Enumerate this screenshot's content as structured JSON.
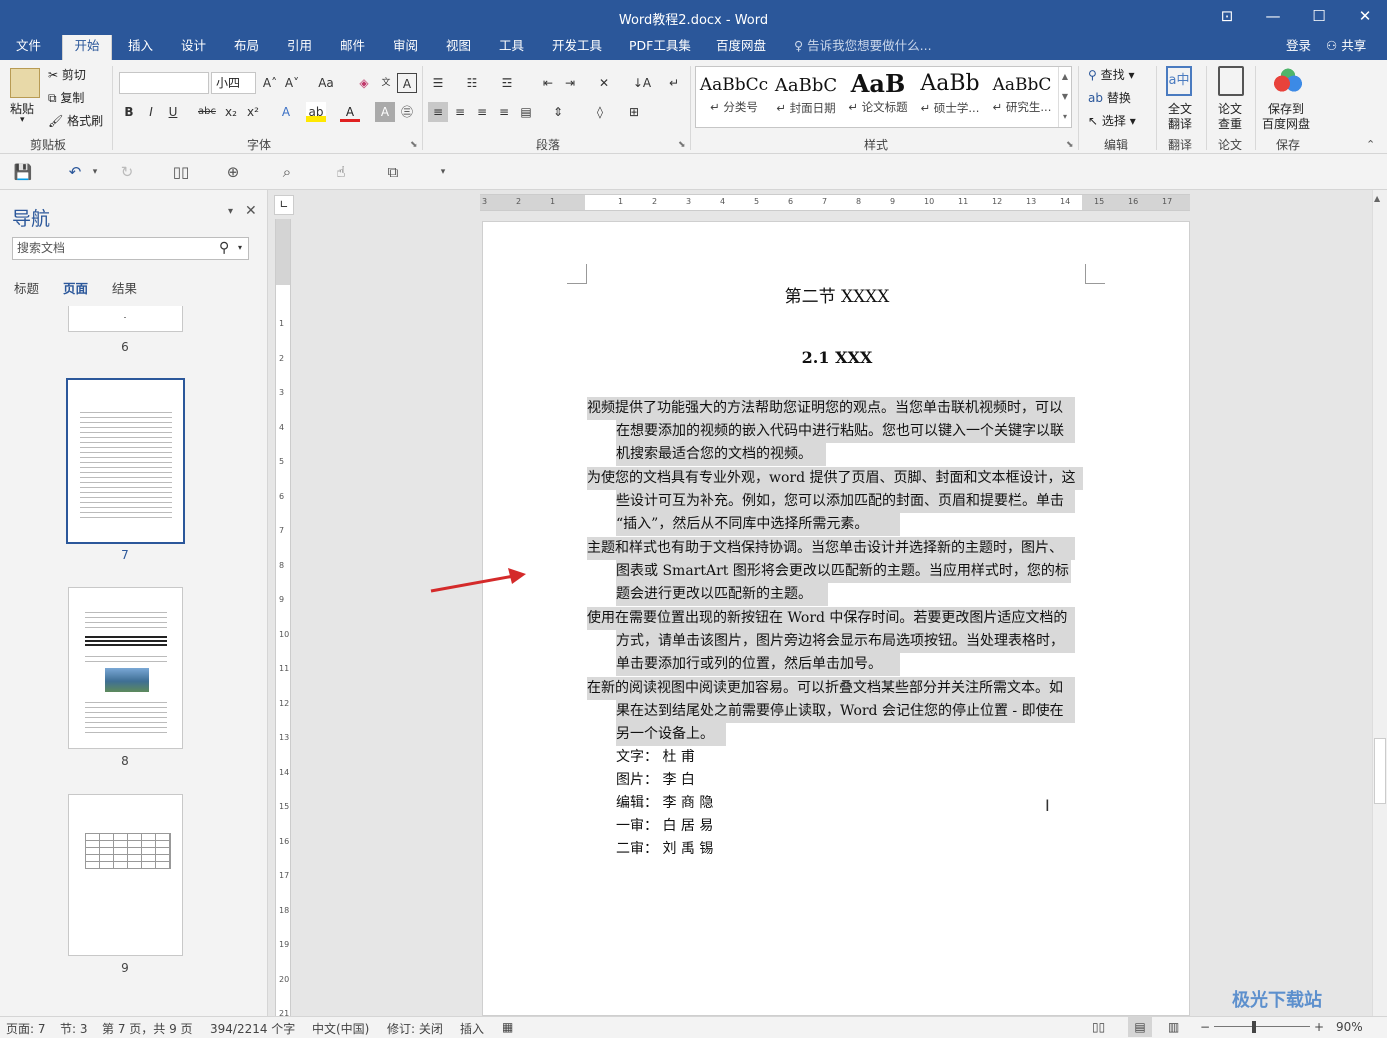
{
  "window": {
    "title": "Word教程2.docx - Word",
    "controls": [
      "⊡",
      "—",
      "☐",
      "✕"
    ]
  },
  "tabs": [
    "文件",
    "开始",
    "插入",
    "设计",
    "布局",
    "引用",
    "邮件",
    "审阅",
    "视图",
    "工具",
    "开发工具",
    "PDF工具集",
    "百度网盘"
  ],
  "tell_me": "告诉我您想要做什么...",
  "account": {
    "login": "登录",
    "share": "共享"
  },
  "ribbon": {
    "clipboard": {
      "paste": "粘贴",
      "cut": "剪切",
      "copy": "复制",
      "format_painter": "格式刷",
      "label": "剪贴板"
    },
    "font": {
      "font_name": "",
      "font_size": "小四",
      "label": "字体",
      "change_case": "Aa"
    },
    "paragraph": {
      "label": "段落"
    },
    "styles": {
      "label": "样式",
      "items": [
        {
          "sample": "AaBbCc",
          "name": "↵ 分类号"
        },
        {
          "sample": "AaBbC",
          "name": "↵ 封面日期"
        },
        {
          "sample": "AaB",
          "name": "↵ 论文标题"
        },
        {
          "sample": "AaBb",
          "name": "↵ 硕士学..."
        },
        {
          "sample": "AaBbC",
          "name": "↵ 研究生..."
        }
      ]
    },
    "editing": {
      "find": "查找",
      "replace": "替换",
      "select": "选择",
      "label": "编辑"
    },
    "translate": {
      "btn": "全文\n翻译",
      "btn1": "全文",
      "btn2": "翻译",
      "label": "翻译"
    },
    "paper": {
      "btn1": "论文",
      "btn2": "查重",
      "label": "论文"
    },
    "save": {
      "btn1": "保存到",
      "btn2": "百度网盘",
      "label": "保存"
    }
  },
  "nav": {
    "title": "导航",
    "search_placeholder": "搜索文档",
    "tabs": [
      "标题",
      "页面",
      "结果"
    ],
    "pages": [
      "6",
      "7",
      "8",
      "9"
    ]
  },
  "document": {
    "heading1": "第二节  XXXX",
    "heading2": "2.1 XXX",
    "lines": [
      "视频提供了功能强大的方法帮助您证明您的观点。当您单击联机视频时，可以",
      "在想要添加的视频的嵌入代码中进行粘贴。您也可以键入一个关键字以联",
      "机搜索最适合您的文档的视频。",
      "为使您的文档具有专业外观，word 提供了页眉、页脚、封面和文本框设计，这",
      "些设计可互为补充。例如，您可以添加匹配的封面、页眉和提要栏。单击",
      "“插入”，然后从不同库中选择所需元素。",
      "主题和样式也有助于文档保持协调。当您单击设计并选择新的主题时，图片、",
      "图表或 SmartArt 图形将会更改以匹配新的主题。当应用样式时，您的标",
      "题会进行更改以匹配新的主题。",
      "使用在需要位置出现的新按钮在 Word 中保存时间。若要更改图片适应文档的",
      "方式，请单击该图片，图片旁边将会显示布局选项按钮。当处理表格时，",
      "单击要添加行或列的位置，然后单击加号。",
      "在新的阅读视图中阅读更加容易。可以折叠文档某些部分并关注所需文本。如",
      "果在达到结尾处之前需要停止读取，Word 会记住您的停止位置 - 即使在",
      "另一个设备上。"
    ],
    "credits": [
      "文字：  杜    甫",
      "图片：  李    白",
      "编辑：  李 商 隐",
      "一审：  白 居 易",
      "二审：  刘 禹 锡"
    ]
  },
  "status": {
    "page": "页面: 7",
    "section": "节: 3",
    "page_of": "第 7 页，共 9 页",
    "words": "394/2214 个字",
    "language": "中文(中国)",
    "track": "修订: 关闭",
    "mode": "插入",
    "zoom": "90%"
  },
  "watermark": "极光下载站",
  "colors": {
    "accent": "#2b579a",
    "highlight": "#d9d9d9",
    "arrow": "#d42a2a"
  }
}
